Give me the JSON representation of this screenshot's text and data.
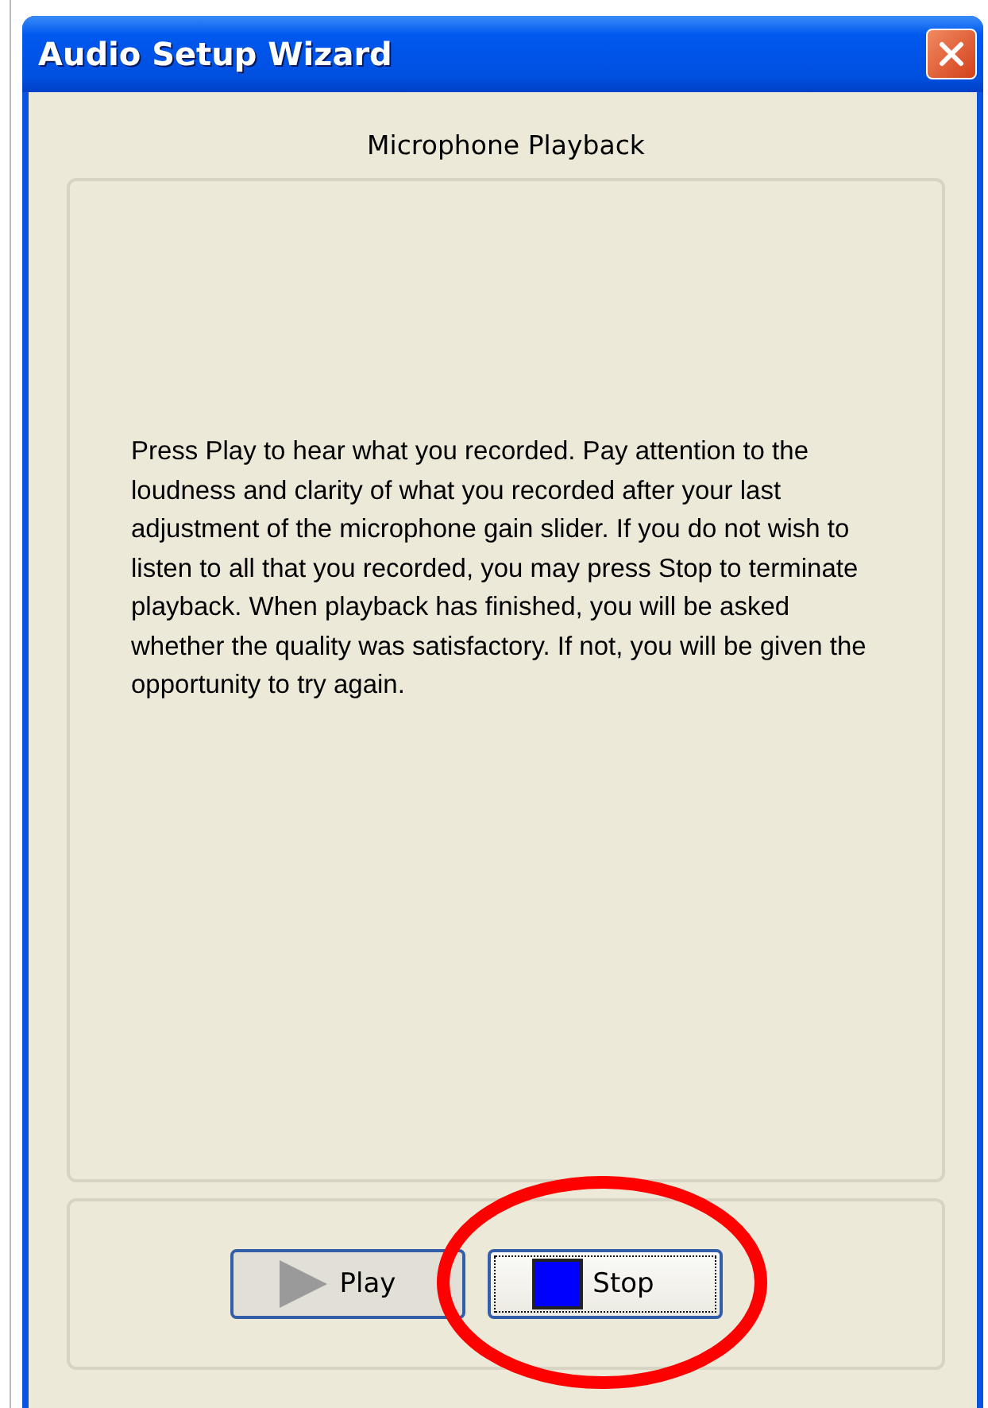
{
  "window": {
    "title": "Audio Setup Wizard"
  },
  "heading": "Microphone Playback",
  "instructions": "Press Play to hear what you recorded.  Pay attention to the loudness and clarity of what you recorded after your last adjustment of the microphone gain slider.  If you do not wish to listen to all that you recorded, you may press Stop to terminate playback.  When playback has finished, you will be asked whether the quality was satisfactory.  If not, you will be given the opportunity to try again.",
  "buttons": [
    {
      "kind": "play",
      "label": "Play",
      "pressed": true,
      "focused": false,
      "circled": false
    },
    {
      "kind": "stop",
      "label": "Stop",
      "pressed": false,
      "focused": true,
      "circled": true
    }
  ]
}
